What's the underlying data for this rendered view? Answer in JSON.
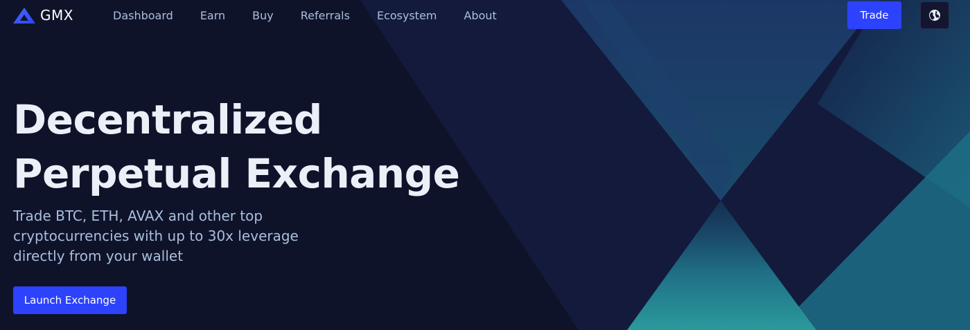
{
  "header": {
    "logo_text": "GMX",
    "nav": [
      {
        "label": "Dashboard"
      },
      {
        "label": "Earn"
      },
      {
        "label": "Buy"
      },
      {
        "label": "Referrals"
      },
      {
        "label": "Ecosystem"
      },
      {
        "label": "About"
      }
    ],
    "trade_label": "Trade",
    "language_icon": "globe-icon"
  },
  "hero": {
    "title_line1": "Decentralized",
    "title_line2": "Perpetual Exchange",
    "subtitle_line1": "Trade BTC, ETH, AVAX and other top",
    "subtitle_line2": "cryptocurrencies with up to 30x leverage",
    "subtitle_line3": "directly from your wallet",
    "cta_label": "Launch Exchange"
  },
  "colors": {
    "background": "#10142b",
    "accent": "#2d42fc",
    "nav_text": "#a9bfdc",
    "title_text": "#ebf0f8",
    "teal": "#2a8e95"
  }
}
